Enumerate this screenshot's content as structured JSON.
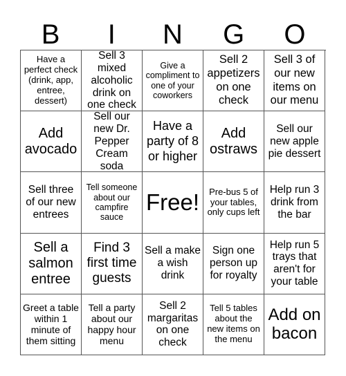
{
  "header": {
    "letters": [
      "B",
      "I",
      "N",
      "G",
      "O"
    ]
  },
  "grid": {
    "rows": [
      [
        "Have a perfect check (drink, app, entree, dessert)",
        "Sell 3 mixed alcoholic drink on one check",
        "Give a compliment to one of your coworkers",
        "Sell 2 appetizers on one check",
        "Sell 3 of our new items on our menu"
      ],
      [
        "Add avocado",
        "Sell our new Dr. Pepper Cream soda",
        "Have a party of 8 or higher",
        "Add ostraws",
        "Sell our new apple pie dessert"
      ],
      [
        "Sell three of our new entrees",
        "Tell someone about our campfire sauce",
        "Free!",
        "Pre-bus 5 of your tables, only cups left",
        "Help run 3 drink from the bar"
      ],
      [
        "Sell a salmon entree",
        "Find 3 first time guests",
        "Sell a make a wish drink",
        "Sign one person up for royalty",
        "Help run 5 trays that aren't for your table"
      ],
      [
        "Greet a table within 1 minute of them sitting",
        "Tell a party about our happy hour menu",
        "Sell 2 margaritas on one check",
        "Tell 5 tables about the new items on the menu",
        "Add on bacon"
      ]
    ]
  }
}
